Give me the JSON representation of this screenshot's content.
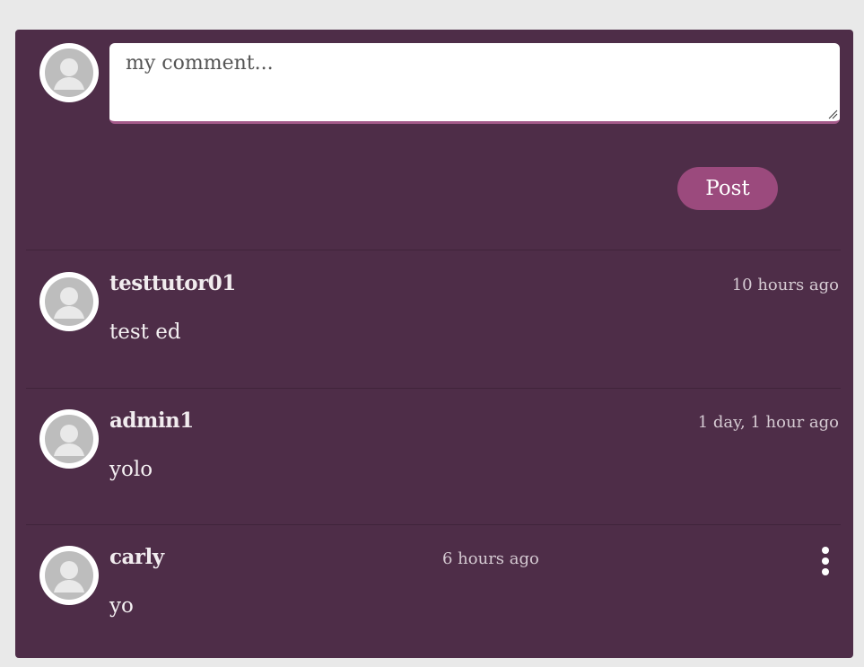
{
  "composer": {
    "placeholder": "my comment...",
    "post_label": "Post"
  },
  "comments": [
    {
      "username": "testtutor01",
      "time": "10 hours ago",
      "text": "test ed"
    },
    {
      "username": "admin1",
      "time": "1 day, 1 hour ago",
      "text": "yolo"
    },
    {
      "username": "carly",
      "time": "6 hours ago",
      "text": "yo"
    }
  ],
  "colors": {
    "page_bg": "#e9e9e9",
    "panel_bg": "#4e2d48",
    "accent": "#9b4a7d"
  }
}
